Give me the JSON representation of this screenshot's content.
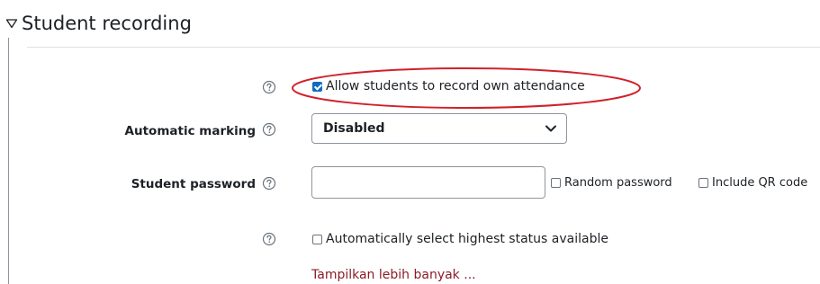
{
  "section": {
    "title": "Student recording",
    "toggle_icon": "triangle-down-icon"
  },
  "fields": {
    "allow_self_record": {
      "label": "Allow students to record own attendance",
      "checked": true
    },
    "automatic_marking": {
      "label": "Automatic marking",
      "value": "Disabled"
    },
    "student_password": {
      "label": "Student password",
      "value": "",
      "random_password_label": "Random password",
      "include_qr_label": "Include QR code"
    },
    "highest_status": {
      "label": "Automatically select highest status available",
      "checked": false
    }
  },
  "show_more_link": "Tampilkan lebih banyak ...",
  "colors": {
    "link": "#8a1c28",
    "annotation": "#d0212a",
    "checkbox_checked": "#0f6cbf",
    "help_icon": "#6a737b"
  }
}
